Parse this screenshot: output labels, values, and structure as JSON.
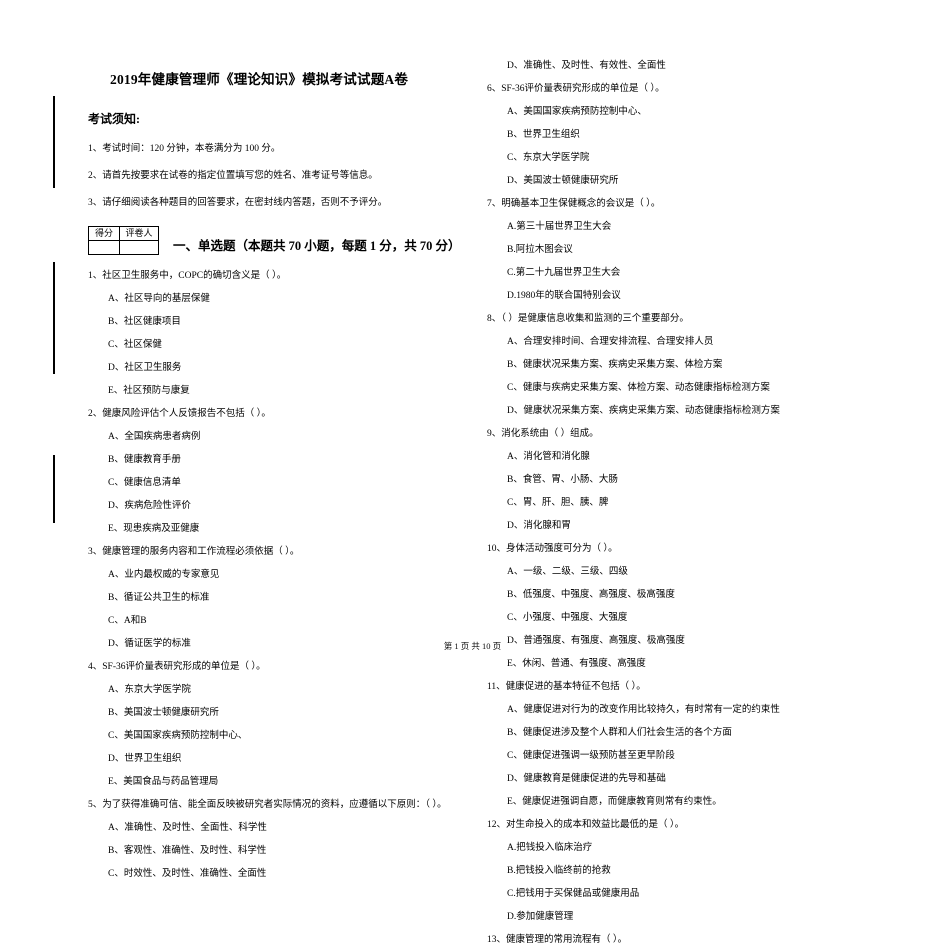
{
  "document": {
    "title": "2019年健康管理师《理论知识》模拟考试试题A卷",
    "footer": "第 1 页 共 10 页"
  },
  "notice": {
    "heading": "考试须知:",
    "lines": [
      "1、考试时间：120 分钟，本卷满分为 100 分。",
      "2、请首先按要求在试卷的指定位置填写您的姓名、准考证号等信息。",
      "3、请仔细阅读各种题目的回答要求，在密封线内答题，否则不予评分。"
    ]
  },
  "score_table": {
    "headers": [
      "得分",
      "评卷人"
    ],
    "values": [
      "",
      ""
    ]
  },
  "section": {
    "heading": "一、单选题（本题共 70 小题，每题 1 分，共 70 分）"
  },
  "left_column": [
    {
      "stem": "1、社区卫生服务中，COPC的确切含义是（     ）。",
      "options": [
        "A、社区导向的基层保健",
        "B、社区健康项目",
        "C、社区保健",
        "D、社区卫生服务",
        "E、社区预防与康复"
      ]
    },
    {
      "stem": "2、健康风险评估个人反馈报告不包括（     ）。",
      "options": [
        "A、全国疾病患者病例",
        "B、健康教育手册",
        "C、健康信息清单",
        "D、疾病危险性评价",
        "E、现患疾病及亚健康"
      ]
    },
    {
      "stem": "3、健康管理的服务内容和工作流程必须依据（     ）。",
      "options": [
        "A、业内最权威的专家意见",
        "B、循证公共卫生的标准",
        "C、A和B",
        "D、循证医学的标准"
      ]
    },
    {
      "stem": "4、SF-36评价量表研究形成的单位是（     ）。",
      "options": [
        "A、东京大学医学院",
        "B、美国波士顿健康研究所",
        "C、美国国家疾病预防控制中心、",
        "D、世界卫生组织",
        "E、美国食品与药品管理局"
      ]
    },
    {
      "stem": "5、为了获得准确可信、能全面反映被研究者实际情况的资料，应遵循以下原则：（     ）。",
      "options": [
        "A、准确性、及时性、全面性、科学性",
        "B、客观性、准确性、及时性、科学性",
        "C、时效性、及时性、准确性、全面性"
      ]
    }
  ],
  "right_column": [
    {
      "stem": "",
      "options": [
        "D、准确性、及时性、有效性、全面性"
      ]
    },
    {
      "stem": "6、SF-36评价量表研究形成的单位是（     ）。",
      "options": [
        "A、美国国家疾病预防控制中心、",
        "B、世界卫生组织",
        "C、东京大学医学院",
        "D、美国波士顿健康研究所"
      ]
    },
    {
      "stem": "7、明确基本卫生保健概念的会议是（     ）。",
      "options": [
        "A.第三十届世界卫生大会",
        "B.阿拉木图会议",
        "C.第二十九届世界卫生大会",
        "D.1980年的联合国特别会议"
      ]
    },
    {
      "stem": "8、（     ）是健康信息收集和监测的三个重要部分。",
      "options": [
        "A、合理安排时间、合理安排流程、合理安排人员",
        "B、健康状况采集方案、疾病史采集方案、体检方案",
        "C、健康与疾病史采集方案、体检方案、动态健康指标检测方案",
        "D、健康状况采集方案、疾病史采集方案、动态健康指标检测方案"
      ]
    },
    {
      "stem": "9、消化系统由（     ）组成。",
      "options": [
        "A、消化管和消化腺",
        "B、食管、胃、小肠、大肠",
        "C、胃、肝、胆、胰、脾",
        "D、消化腺和胃"
      ]
    },
    {
      "stem": "10、身体活动强度可分为（     ）。",
      "options": [
        "A、一级、二级、三级、四级",
        "B、低强度、中强度、高强度、极高强度",
        "C、小强度、中强度、大强度",
        "D、普通强度、有强度、高强度、极高强度",
        "E、休闲、普通、有强度、高强度"
      ]
    },
    {
      "stem": "11、健康促进的基本特征不包括（     ）。",
      "options": [
        "A、健康促进对行为的改变作用比较持久，有时常有一定的约束性",
        "B、健康促进涉及整个人群和人们社会生活的各个方面",
        "C、健康促进强调一级预防甚至更早阶段",
        "D、健康教育是健康促进的先导和基础",
        "E、健康促进强调自愿，而健康教育则常有约束性。"
      ]
    },
    {
      "stem": "12、对生命投入的成本和效益比最低的是（     ）。",
      "options": [
        "A.把钱投入临床治疗",
        "B.把钱投入临终前的抢救",
        "C.把钱用于买保健品或健康用品",
        "D.参加健康管理"
      ]
    },
    {
      "stem": "13、健康管理的常用流程有（     ）。",
      "options": []
    }
  ]
}
